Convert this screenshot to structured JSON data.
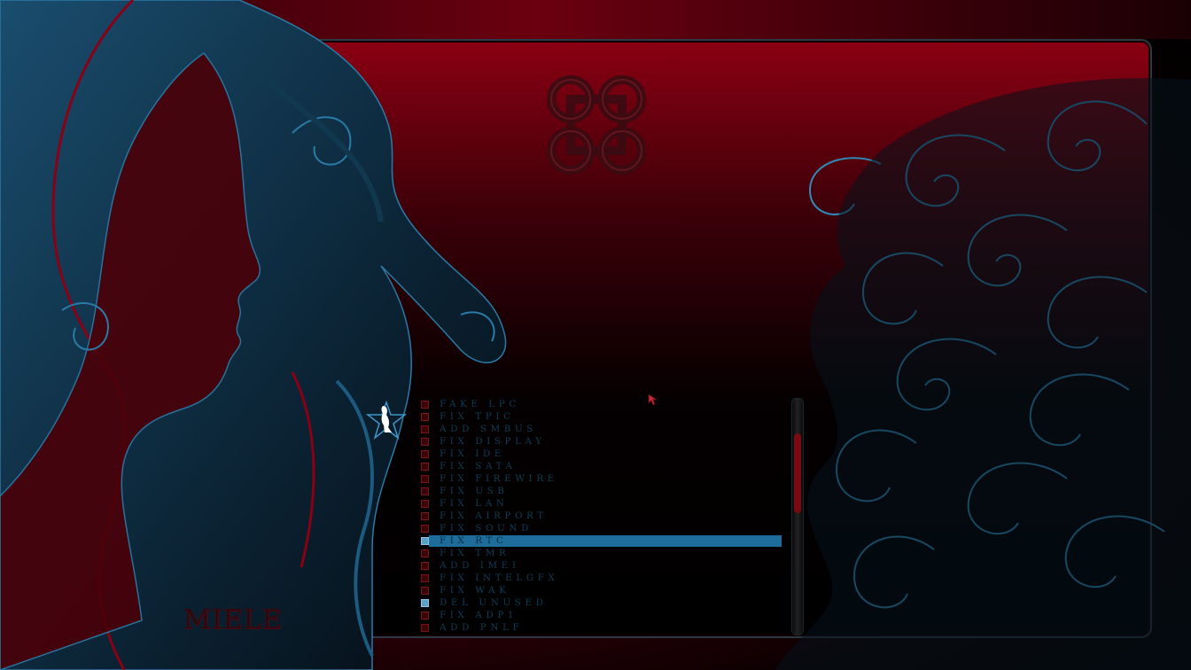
{
  "brand": {
    "name": "MIELE"
  },
  "boot_menu": {
    "items": [
      {
        "label": "FAKE LPC",
        "checked": false,
        "selected": false
      },
      {
        "label": "FIX TPIC",
        "checked": false,
        "selected": false
      },
      {
        "label": "ADD SMBUS",
        "checked": false,
        "selected": false
      },
      {
        "label": "FIX DISPLAY",
        "checked": false,
        "selected": false
      },
      {
        "label": "FIX IDE",
        "checked": false,
        "selected": false
      },
      {
        "label": "FIX SATA",
        "checked": false,
        "selected": false
      },
      {
        "label": "FIX FIREWIRE",
        "checked": false,
        "selected": false
      },
      {
        "label": "FIX USB",
        "checked": false,
        "selected": false
      },
      {
        "label": "FIX LAN",
        "checked": false,
        "selected": false
      },
      {
        "label": "FIX AIRPORT",
        "checked": false,
        "selected": false
      },
      {
        "label": "FIX SOUND",
        "checked": false,
        "selected": false
      },
      {
        "label": "FIX RTC",
        "checked": true,
        "selected": true
      },
      {
        "label": "FIX TMR",
        "checked": false,
        "selected": false
      },
      {
        "label": "ADD IMEI",
        "checked": false,
        "selected": false
      },
      {
        "label": "FIX INTELGFX",
        "checked": false,
        "selected": false
      },
      {
        "label": "FIX WAK",
        "checked": false,
        "selected": false
      },
      {
        "label": "DEL UNUSED",
        "checked": true,
        "selected": false
      },
      {
        "label": "FIX ADP1",
        "checked": false,
        "selected": false
      },
      {
        "label": "ADD PNLF",
        "checked": false,
        "selected": false
      }
    ]
  },
  "scrollbar": {
    "position": 0.22,
    "visible_fraction": 0.34
  },
  "icons": {
    "center": "command-key-icon",
    "menu_badge": "pinup-star-icon",
    "pointer": "mouse-pointer-icon"
  },
  "colors": {
    "accent": "#1d6c9a",
    "label": "#0e3d56",
    "bg_red": "#7a0010",
    "line_blue": "#2b7aa6"
  }
}
